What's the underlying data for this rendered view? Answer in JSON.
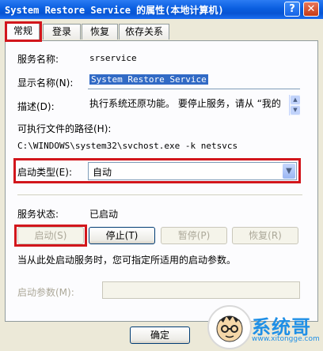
{
  "window": {
    "title": "System Restore Service 的属性(本地计算机)",
    "help_label": "?",
    "close_label": "✕"
  },
  "tabs": [
    "常规",
    "登录",
    "恢复",
    "依存关系"
  ],
  "general": {
    "service_name_label": "服务名称:",
    "service_name_value": "srservice",
    "display_name_label": "显示名称(N):",
    "display_name_value": "System Restore Service",
    "description_label": "描述(D):",
    "description_value": "执行系统还原功能。 要停止服务，请从 “我的",
    "exe_path_label": "可执行文件的路径(H):",
    "exe_path_value": "C:\\WINDOWS\\system32\\svchost.exe -k netsvcs",
    "startup_type_label": "启动类型(E):",
    "startup_type_value": "自动",
    "service_status_label": "服务状态:",
    "service_status_value": "已启动",
    "buttons": {
      "start": "启动(S)",
      "stop": "停止(T)",
      "pause": "暂停(P)",
      "resume": "恢复(R)"
    },
    "hint_text": "当从此处启动服务时，您可指定所适用的启动参数。",
    "start_params_label": "启动参数(M):",
    "start_params_value": ""
  },
  "footer": {
    "ok_label": "确定"
  },
  "watermark": {
    "brand": "系统哥",
    "url": "www.xitongge.com"
  },
  "colors": {
    "title_bar": "#0a5ee0",
    "highlight_box": "#d2161c",
    "selection": "#316ac5"
  }
}
